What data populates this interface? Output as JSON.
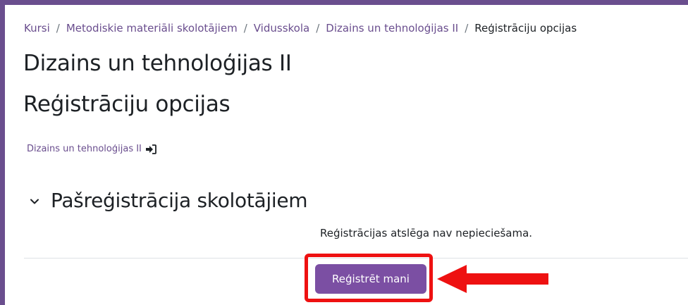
{
  "breadcrumb": {
    "items": [
      "Kursi",
      "Metodiskie materiāli skolotājiem",
      "Vidusskola",
      "Dizains un tehnoloģijas II"
    ],
    "current": "Reģistrāciju opcijas",
    "separator": "/"
  },
  "course_title": "Dizains un tehnoloģijas II",
  "page_title": "Reģistrāciju opcijas",
  "course_link": {
    "label": "Dizains un tehnoloģijas II",
    "icon": "enter-icon"
  },
  "section": {
    "icon": "chevron-down-icon",
    "title": "Pašreģistrācija skolotājiem",
    "info": "Reģistrācijas atslēga nav nepieciešama."
  },
  "enrol_button": {
    "label": "Reģistrēt mani"
  },
  "annotation": {
    "highlight_color": "#ee1111",
    "arrow_color": "#ee1111"
  },
  "colors": {
    "frame": "#6a4e8e",
    "link": "#6a4e8e",
    "button": "#7b4fa3"
  }
}
